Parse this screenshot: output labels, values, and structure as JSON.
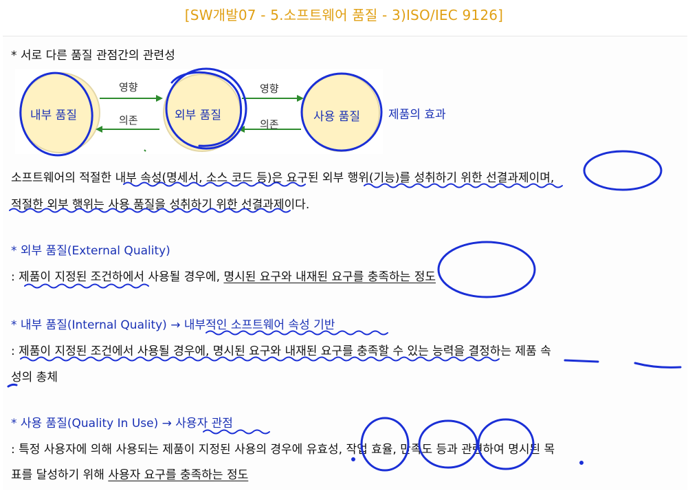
{
  "title": "[SW개발07 - 5.소프트웨어 품질 - 3)ISO/IEC 9126]",
  "section_heading": "* 서로 다른 품질 관점간의 관련성",
  "diagram": {
    "internal": "내부 품질",
    "external": "외부 품질",
    "in_use": "사용 품질",
    "influence_1": "영향",
    "depend_1": "의존",
    "influence_2": "영향",
    "depend_2": "의존",
    "effect": "제품의 효과"
  },
  "para1": {
    "line1": "소프트웨어의 적절한 내부 속성(명세서, 소스 코드 등)은 요구된 외부 행위(기능)를 성취하기 위한 선결과제이며,",
    "line2": "적절한 외부 행위는 사용 품질을 성취하기 위한 선결과제이다."
  },
  "external": {
    "heading": "* 외부 품질(External Quality)",
    "desc_plain": ": 제품이 지정된 조건하에서 사용될 경우에, ",
    "desc_ul": "명시된 요구와 내재된 요구를 충족하는 정도"
  },
  "internal": {
    "heading_prefix": "* 내부 품질(Internal Quality) → ",
    "heading_ul": "내부적인 소프트웨어 속성 기반",
    "desc_line1": ": 제품이 지정된 조건에서 사용될 경우에, 명시된 요구와 내재된 요구를 충족할 수 있는 능력을 결정하는 제품 속",
    "desc_line2": "성의 총체"
  },
  "in_use": {
    "heading_prefix": "* 사용 품질(Quality In Use) → ",
    "heading_ul": "사용자 관점",
    "desc_line1": ": 특정 사용자에 의해 사용되는 제품이 지정된 사용의 경우에 유효성, 작업 효율, 만족도 등과 관련하여 명시된 목",
    "desc_line2_plain": "표를 달성하기 위해 ",
    "desc_line2_ul": "사용자 요구를 충족하는 정도"
  },
  "colors": {
    "title": "#e0a015",
    "accent": "#1a31b5",
    "ink": "#1a2fd6",
    "circle_fill": "#fff2c2"
  }
}
